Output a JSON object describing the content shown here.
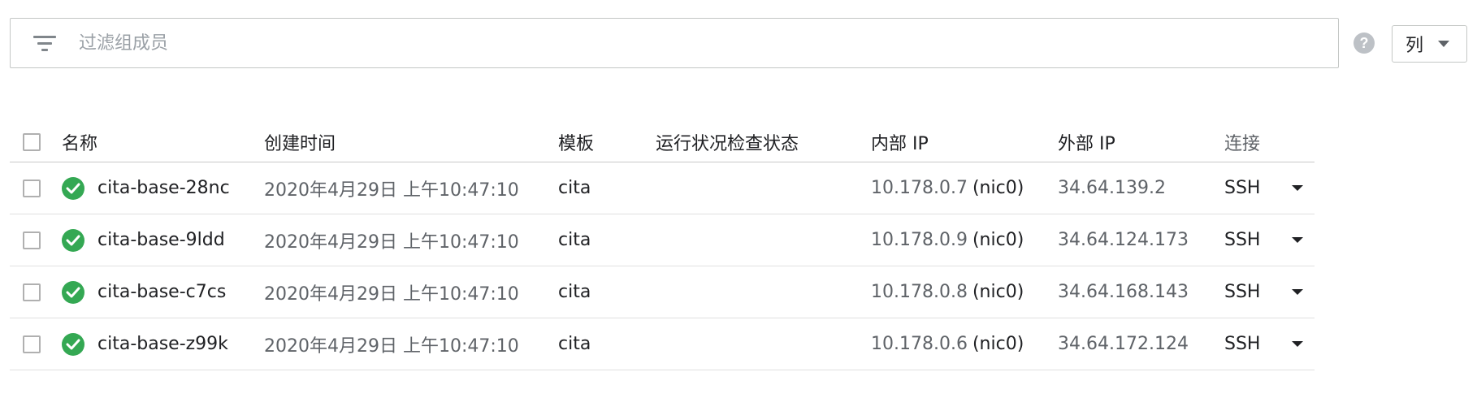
{
  "filter": {
    "placeholder": "过滤组成员",
    "icon": "filter-icon"
  },
  "toolbar": {
    "help_icon": "help-icon",
    "help_symbol": "?",
    "columns_label": "列"
  },
  "table": {
    "headers": {
      "name": "名称",
      "created": "创建时间",
      "template": "模板",
      "health": "运行状况检查状态",
      "internal_ip": "内部 IP",
      "external_ip": "外部 IP",
      "connect": "连接"
    },
    "rows": [
      {
        "name": "cita-base-28nc",
        "created": "2020年4月29日 上午10:47:10",
        "template": "cita",
        "health": "",
        "internal_ip": "10.178.0.7",
        "nic": "(nic0)",
        "external_ip": "34.64.139.2",
        "connect": "SSH"
      },
      {
        "name": "cita-base-9ldd",
        "created": "2020年4月29日 上午10:47:10",
        "template": "cita",
        "health": "",
        "internal_ip": "10.178.0.9",
        "nic": "(nic0)",
        "external_ip": "34.64.124.173",
        "connect": "SSH"
      },
      {
        "name": "cita-base-c7cs",
        "created": "2020年4月29日 上午10:47:10",
        "template": "cita",
        "health": "",
        "internal_ip": "10.178.0.8",
        "nic": "(nic0)",
        "external_ip": "34.64.168.143",
        "connect": "SSH"
      },
      {
        "name": "cita-base-z99k",
        "created": "2020年4月29日 上午10:47:10",
        "template": "cita",
        "health": "",
        "internal_ip": "10.178.0.6",
        "nic": "(nic0)",
        "external_ip": "34.64.172.124",
        "connect": "SSH"
      }
    ]
  },
  "colors": {
    "status_ok": "#34a853",
    "border": "#c4c7c5",
    "muted_text": "#5f6368"
  }
}
